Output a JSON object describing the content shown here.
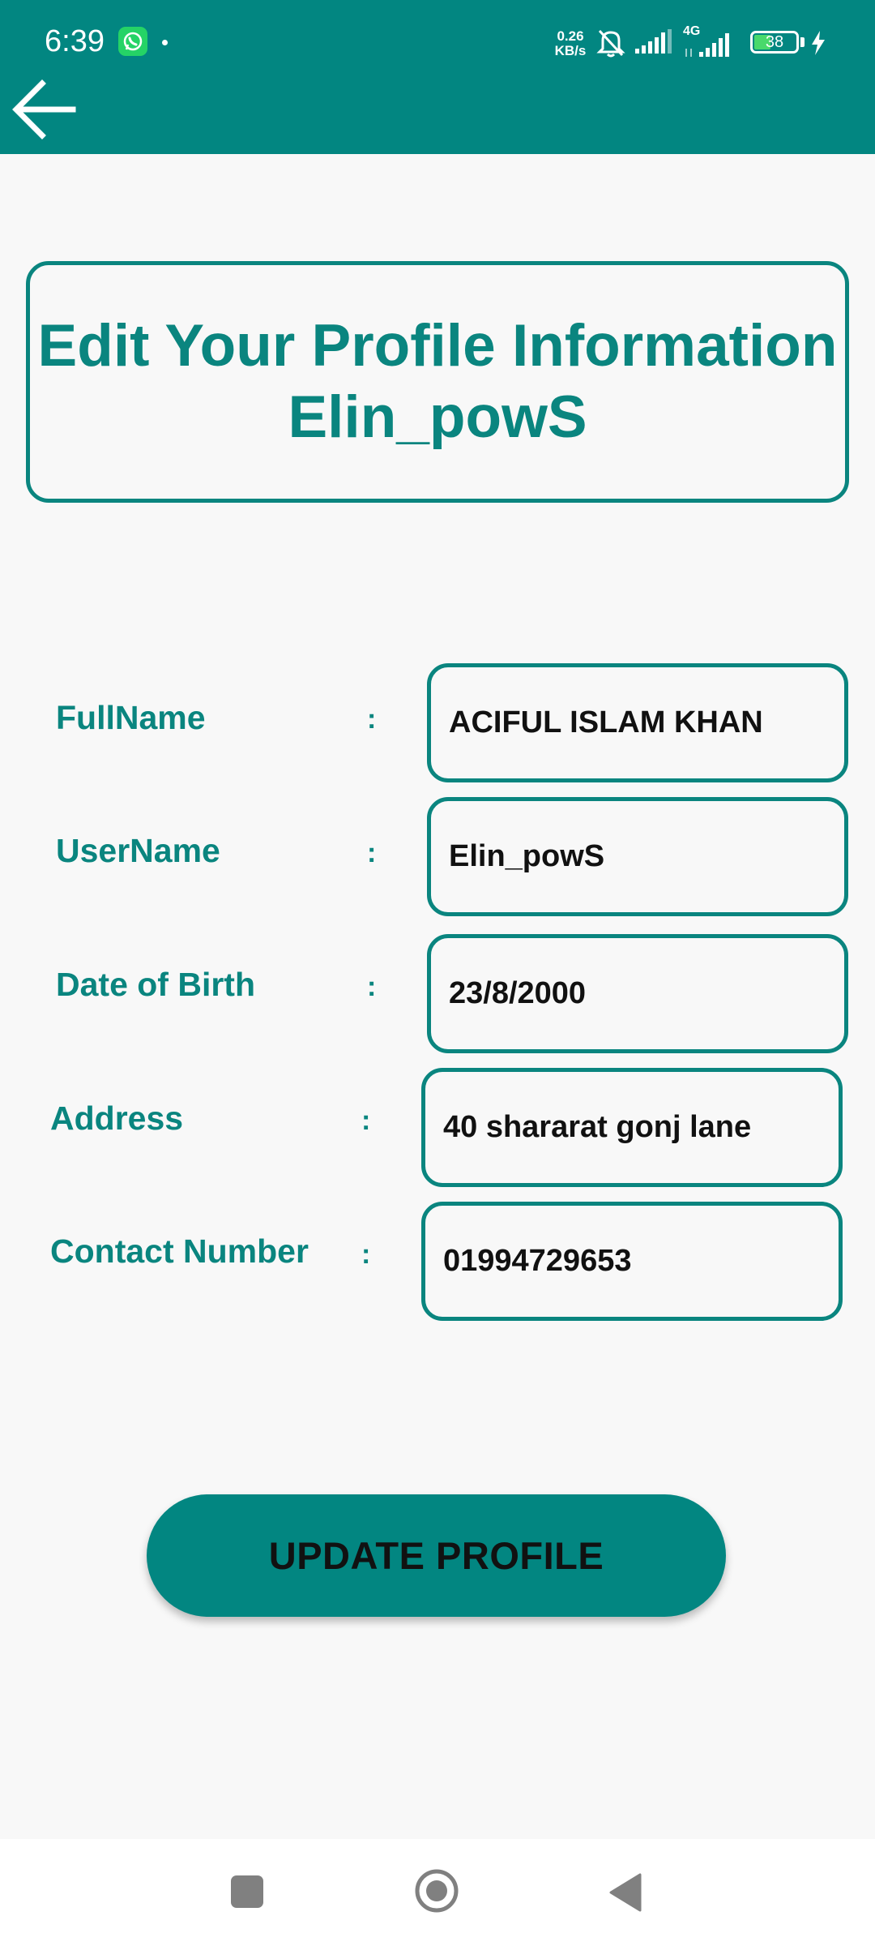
{
  "status_bar": {
    "time": "6:39",
    "net_speed_value": "0.26",
    "net_speed_unit": "KB/s",
    "network_label": "4G",
    "battery_level": "38",
    "icons": [
      "whatsapp-icon",
      "mute-bell-icon",
      "signal-icon",
      "signal-4g-icon",
      "battery-icon",
      "charging-icon"
    ]
  },
  "app_bar": {
    "back_icon": "arrow-left-icon"
  },
  "header": {
    "title_line1": "Edit Your Profile Information",
    "title_line2": "Elin_powS"
  },
  "form": {
    "separator": ":",
    "fields": [
      {
        "label": "FullName",
        "value": "ACIFUL ISLAM KHAN"
      },
      {
        "label": "UserName",
        "value": "Elin_powS"
      },
      {
        "label": "Date of Birth",
        "value": "23/8/2000"
      },
      {
        "label": "Address",
        "value": "40 shararat gonj lane"
      },
      {
        "label": "Contact Number",
        "value": "01994729653"
      }
    ]
  },
  "actions": {
    "update_label": "UPDATE PROFILE"
  },
  "nav_bar": {
    "icons": [
      "recents-square-icon",
      "home-circle-icon",
      "back-triangle-icon"
    ]
  },
  "colors": {
    "primary": "#028681",
    "accent_text": "#0a857f",
    "background": "#f8f8f8"
  }
}
